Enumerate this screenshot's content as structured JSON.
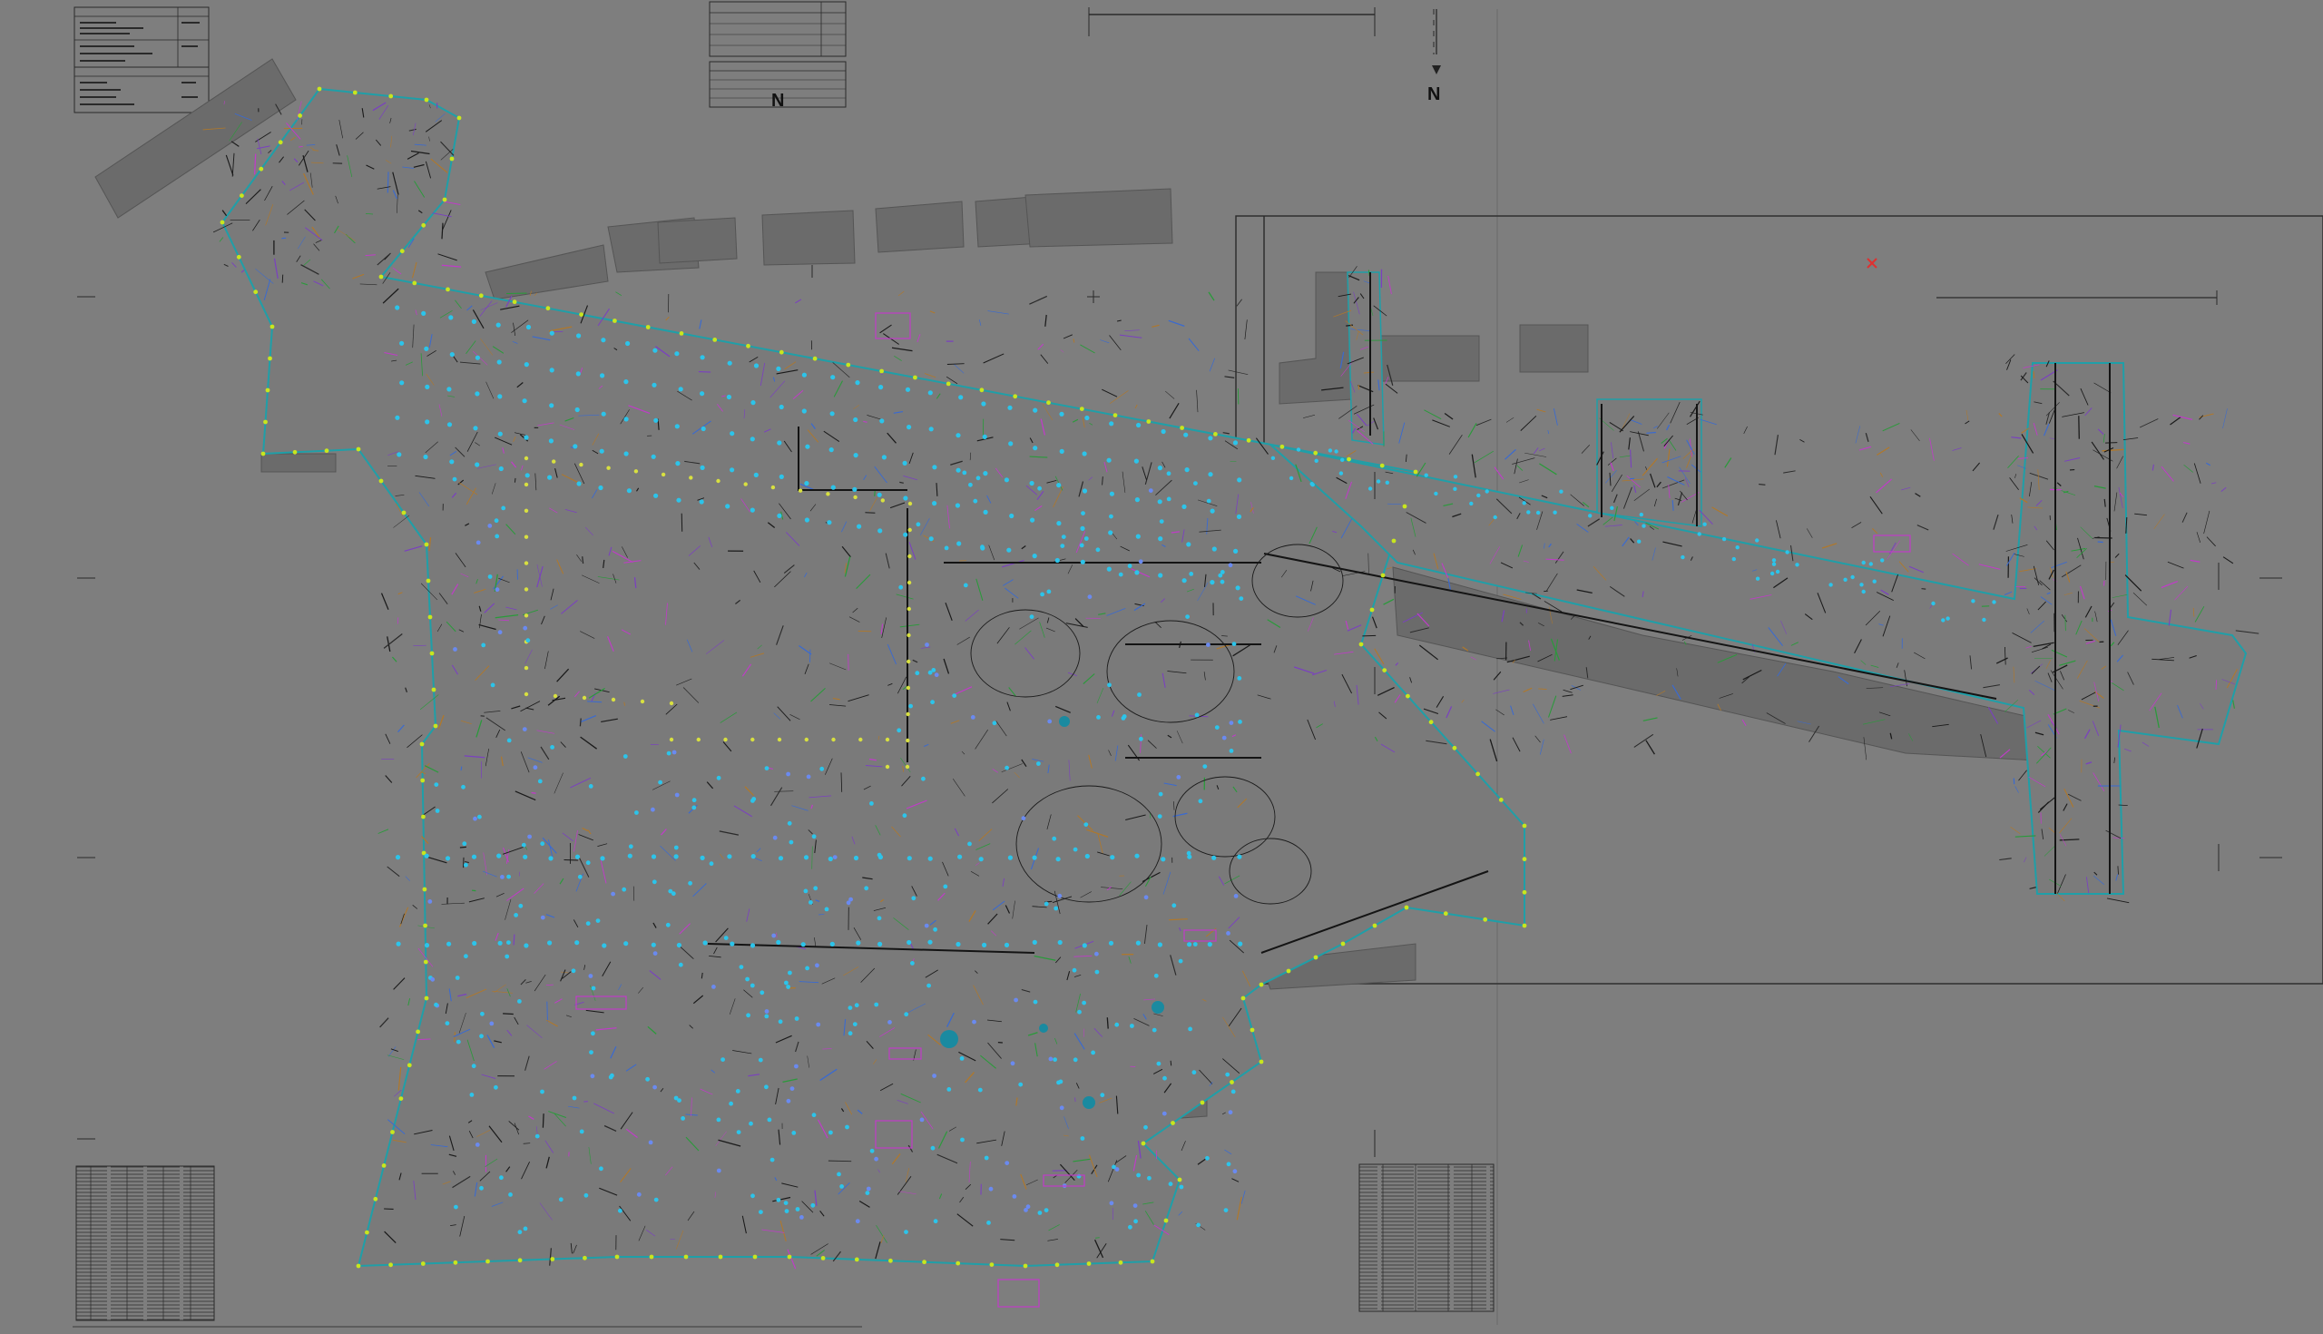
{
  "app": {
    "name": "",
    "document": ""
  },
  "drawing": {
    "north_label": "N",
    "background": "#7e7e7e",
    "sheet_color": "#777777",
    "boundary_color": "#1f9fa8",
    "vertex_color": "#c8e61e",
    "point_color": "#2cc4ea",
    "line_color": "#1a1a1a",
    "markup_color": "#c03cc8",
    "building_fill": "#6a6a6a",
    "marker_color": "#e03030"
  },
  "tables": {
    "top_left_legend": "legend-table",
    "top_right_legend": "revision-table",
    "bottom_left_schedule": "point-schedule",
    "bottom_right_schedule": "point-schedule"
  }
}
